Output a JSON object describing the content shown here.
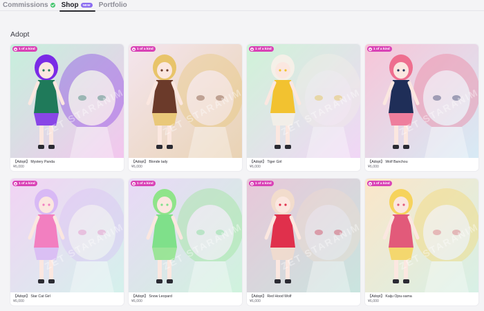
{
  "nav": {
    "tabs": [
      {
        "label": "Commissions"
      },
      {
        "label": "Shop",
        "badge": "NEW"
      },
      {
        "label": "Portfolio"
      }
    ]
  },
  "section": {
    "title": "Adopt"
  },
  "colors": {
    "badge": "#d942b6",
    "status": "#43c46c",
    "new_badge": "#8b6cf0"
  },
  "products": [
    {
      "badge": "1 of a kind",
      "title": "【Adopt】 Mystery Panda",
      "price": "¥6,000",
      "watermark": "ZET STARANIMATION",
      "bg1": "#c6f0dc",
      "bg2": "#f3c6ee",
      "accent": "#1f7a5a",
      "hair": "#7a2be6"
    },
    {
      "badge": "1 of a kind",
      "title": "【Adopt】 Blonde lady",
      "price": "¥6,000",
      "watermark": "ZET STARANIMATION",
      "bg1": "#f4e5ee",
      "bg2": "#e9d3b4",
      "accent": "#6b3a2a",
      "hair": "#e8c46a"
    },
    {
      "badge": "1 of a kind",
      "title": "【Adopt】 Tiger Girl",
      "price": "¥6,000",
      "watermark": "ZET STARANIMATION",
      "bg1": "#cff3d8",
      "bg2": "#f1d6f6",
      "accent": "#f2c230",
      "hair": "#f5f0e8"
    },
    {
      "badge": "1 of a kind",
      "title": "【Adopt】 Wolf Banchou",
      "price": "¥6,000",
      "watermark": "ZET STARANIMATION",
      "bg1": "#f7c5d8",
      "bg2": "#d7eaf5",
      "accent": "#1f2e58",
      "hair": "#ee6f8f"
    },
    {
      "badge": "1 of a kind",
      "title": "【Adopt】 Star Cat Girl",
      "price": "¥6,000",
      "watermark": "ZET STARANIMATION",
      "bg1": "#f2d3f4",
      "bg2": "#d4f1ec",
      "accent": "#f27fc0",
      "hair": "#d8b9f5"
    },
    {
      "badge": "1 of a kind",
      "title": "【Adopt】 Snow Leopard",
      "price": "¥6,000",
      "watermark": "ZET STARANIMATION",
      "bg1": "#e9d8f7",
      "bg2": "#cff3dd",
      "accent": "#7fe08a",
      "hair": "#8fe48a"
    },
    {
      "badge": "1 of a kind",
      "title": "【Adopt】 Red Hood Wolf",
      "price": "¥6,000",
      "watermark": "ZET STARANIMATION",
      "bg1": "#e8c7d9",
      "bg2": "#c9e5df",
      "accent": "#e0304c",
      "hair": "#f2dccc"
    },
    {
      "badge": "1 of a kind",
      "title": "【Adopt】 Kaiju Ojou-sama",
      "price": "¥6,000",
      "watermark": "ZET STARANIMATION",
      "bg1": "#fbe6c9",
      "bg2": "#d7f0e6",
      "accent": "#e25a7a",
      "hair": "#f6d35c"
    }
  ]
}
